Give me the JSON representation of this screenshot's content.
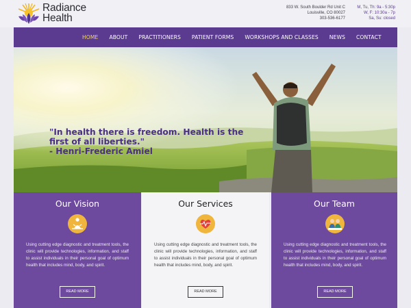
{
  "brand": {
    "line1": "Radiance",
    "line2": "Health"
  },
  "contact": {
    "address_lines": [
      "833 W. South Boulder Rd Unit C",
      "Louisville, CO 80027",
      "303-536-6177"
    ],
    "hours_lines": [
      "M, Tu, Th: 9a - 5:30p",
      "W, F: 10:30a - 7p",
      "Sa, Su: closed"
    ]
  },
  "nav": {
    "items": [
      "Home",
      "About",
      "Practitioners",
      "Patient Forms",
      "Workshops and Classes",
      "News",
      "Contact"
    ],
    "active": "Home"
  },
  "hero": {
    "quote_lines": [
      "\"In health there is freedom. Health is the",
      "first of all liberties.\"",
      "- Henri-Frederic Amiel"
    ]
  },
  "cards": [
    {
      "title": "Our Vision",
      "icon": "meditation-icon",
      "text": "Using cutting edge diagnostic and treatment tools, the clinic will provide technologies, information, and staff to assist individuals in their personal goal of optimum health that includes mind, body, and spirit.",
      "button": "Read More"
    },
    {
      "title": "Our Services",
      "icon": "heart-pulse-icon",
      "text": "Using cutting edge diagnostic and treatment tools, the clinic will provide technologies, information, and staff to assist individuals in their personal goal of optimum health that includes mind, body, and spirit.",
      "button": "Read More"
    },
    {
      "title": "Our Team",
      "icon": "team-icon",
      "text": "Using cutting edge diagnostic and treatment tools, the clinic will provide technologies, information, and staff to assist individuals in their personal goal of optimum health that includes mind, body, and spirit.",
      "button": "Read More"
    }
  ],
  "colors": {
    "brand_purple": "#5b3b8f",
    "card_purple": "#6e4a9e",
    "nav_active": "#f2d66b"
  }
}
